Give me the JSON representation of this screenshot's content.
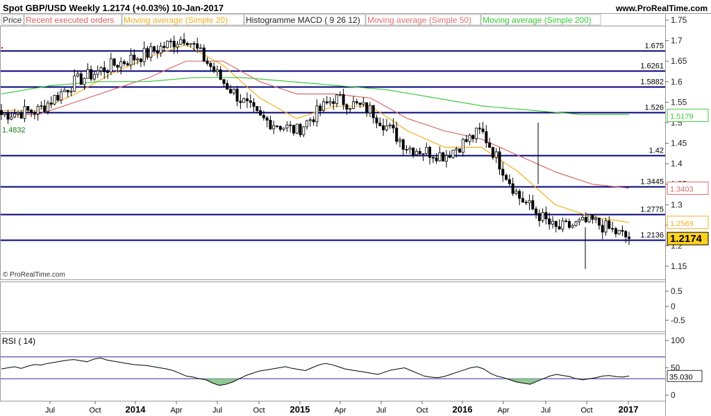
{
  "header": {
    "title": "Spot GBP/USD   Weekly   1.2174 (+0.03%)   10-Jan-2017",
    "site": "www.ProRealTime.com"
  },
  "legend": [
    {
      "label": "Price",
      "color": "#333333"
    },
    {
      "label": "Recent executed orders",
      "color": "#e06060"
    },
    {
      "label": "Moving average (Simple 20)",
      "color": "#f0b020"
    },
    {
      "label": "Histogramme MACD ( 9 26 12)",
      "color": "#222222"
    },
    {
      "label": "Moving average (Simple 50)",
      "color": "#e07070"
    },
    {
      "label": "Moving average (Simple 200)",
      "color": "#33cc33"
    }
  ],
  "copyright": "© ProRealTime.com",
  "colors": {
    "level_line": "#00007a",
    "sma20": "#f0b020",
    "sma50": "#d86a6a",
    "sma200": "#3ec83e",
    "candle": "#000000",
    "current_price_bg": "#ffd21e"
  },
  "badges": {
    "sma200": "1.5179",
    "sma50": "1.3403",
    "sma20": "1.2569",
    "price": "1.2174",
    "rsi": "35.030",
    "left": "1.4832"
  },
  "chart_data": [
    {
      "type": "line",
      "title": "Spot GBP/USD Weekly",
      "ylim": [
        1.12,
        1.76
      ],
      "y_ticks": [
        "1.75",
        "1.7",
        "1.65",
        "1.6",
        "1.55",
        "1.5",
        "1.45",
        "1.4",
        "1.35",
        "1.3",
        "1.25",
        "1.2",
        "1.15"
      ],
      "x_ticks": [
        "Jul",
        "Oct",
        "2014",
        "Apr",
        "Jul",
        "Oct",
        "2015",
        "Apr",
        "Jul",
        "Oct",
        "2016",
        "Apr",
        "Jul",
        "Oct",
        "2017"
      ],
      "levels": [
        1.675,
        1.6261,
        1.5882,
        1.526,
        1.42,
        1.3445,
        1.2775,
        1.2136
      ],
      "level_labels": [
        "1.675",
        "1.6261",
        "1.5882",
        "1.526",
        "1.42",
        "1.3445",
        "1.2775",
        "1.2136"
      ],
      "series": [
        {
          "name": "Price",
          "dates": [
            "2013-05",
            "2013-07",
            "2013-10",
            "2014-01",
            "2014-04",
            "2014-07",
            "2014-10",
            "2015-01",
            "2015-04",
            "2015-07",
            "2015-10",
            "2016-01",
            "2016-04",
            "2016-06",
            "2016-07",
            "2016-10",
            "2016-12",
            "2017-01"
          ],
          "values": [
            1.52,
            1.53,
            1.6,
            1.64,
            1.67,
            1.71,
            1.6,
            1.51,
            1.48,
            1.56,
            1.53,
            1.44,
            1.42,
            1.48,
            1.32,
            1.24,
            1.26,
            1.2174
          ]
        },
        {
          "name": "Moving average (Simple 20)",
          "values": [
            1.53,
            1.53,
            1.57,
            1.62,
            1.66,
            1.69,
            1.64,
            1.56,
            1.51,
            1.54,
            1.54,
            1.48,
            1.44,
            1.44,
            1.38,
            1.3,
            1.27,
            1.2569
          ]
        },
        {
          "name": "Moving average (Simple 50)",
          "values": [
            1.52,
            1.52,
            1.55,
            1.58,
            1.61,
            1.65,
            1.65,
            1.6,
            1.57,
            1.57,
            1.56,
            1.51,
            1.48,
            1.46,
            1.42,
            1.38,
            1.35,
            1.3403
          ]
        },
        {
          "name": "Moving average (Simple 200)",
          "values": [
            1.57,
            1.59,
            1.6,
            1.6,
            1.61,
            1.61,
            1.6,
            1.59,
            1.58,
            1.56,
            1.54,
            1.53,
            1.52,
            1.52
          ]
        }
      ]
    },
    {
      "type": "bar",
      "title": "Histogramme MACD ( 9 26 12)",
      "y_ticks": [
        "0.5",
        "0",
        "-0.5"
      ],
      "ylim": [
        -0.9,
        0.9
      ],
      "values": []
    },
    {
      "type": "line",
      "title": "RSI ( 14)",
      "ylim": [
        0,
        100
      ],
      "y_ticks": [
        "100",
        "50",
        "0"
      ],
      "ref_lines": [
        70,
        30
      ],
      "series": [
        {
          "name": "RSI",
          "values": [
            48,
            50,
            52,
            49,
            53,
            56,
            55,
            58,
            60,
            62,
            64,
            65,
            63,
            61,
            66,
            68,
            64,
            62,
            60,
            58,
            56,
            55,
            54,
            52,
            50,
            48,
            45,
            40,
            35,
            33,
            30,
            28,
            22,
            18,
            20,
            24,
            30,
            36,
            40,
            44,
            46,
            48,
            50,
            52,
            49,
            47,
            45,
            50,
            55,
            58,
            56,
            52,
            48,
            46,
            44,
            42,
            40,
            38,
            42,
            46,
            48,
            50,
            45,
            40,
            35,
            33,
            32,
            34,
            38,
            42,
            46,
            50,
            52,
            48,
            40,
            35,
            32,
            28,
            24,
            22,
            20,
            25,
            30,
            35,
            38,
            36,
            34,
            30,
            28,
            30,
            32,
            35,
            36,
            34,
            33,
            35.03
          ]
        }
      ]
    }
  ]
}
